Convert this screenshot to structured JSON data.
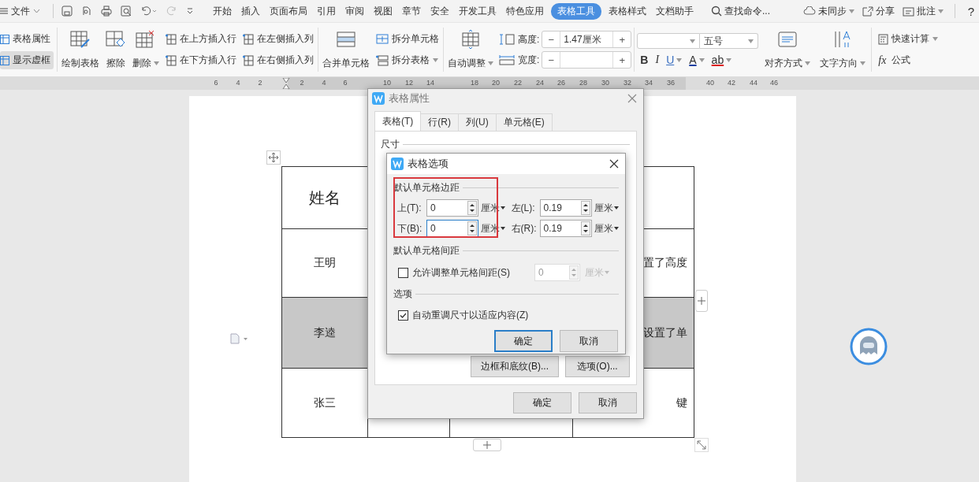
{
  "menu_bar": {
    "file": "文件",
    "tabs": [
      {
        "label": "开始",
        "selected": false
      },
      {
        "label": "插入",
        "selected": false
      },
      {
        "label": "页面布局",
        "selected": false
      },
      {
        "label": "引用",
        "selected": false
      },
      {
        "label": "审阅",
        "selected": false
      },
      {
        "label": "视图",
        "selected": false
      },
      {
        "label": "章节",
        "selected": false
      },
      {
        "label": "安全",
        "selected": false
      },
      {
        "label": "开发工具",
        "selected": false
      },
      {
        "label": "特色应用",
        "selected": false
      },
      {
        "label": "表格工具",
        "selected": true
      },
      {
        "label": "表格样式",
        "selected": false
      },
      {
        "label": "文档助手",
        "selected": false
      }
    ],
    "search": {
      "placeholder": "查找命令..."
    },
    "sync": "未同步",
    "share": "分享",
    "comment": "批注",
    "help": "?"
  },
  "ribbon": {
    "toggles": [
      {
        "label": "表格属性",
        "selected": false
      },
      {
        "label": "显示虚框",
        "selected": true
      }
    ],
    "draw": "绘制表格",
    "erase": "擦除",
    "delete": "删除",
    "insert": [
      "在上方插入行",
      "在下方插入行",
      "在左侧插入列",
      "在右侧插入列"
    ],
    "merge": "合并单元格",
    "split_cells": "拆分单元格",
    "split_table": "拆分表格",
    "autofit": "自动调整",
    "height": {
      "label": "高度:",
      "minus": "−",
      "value": "1.47厘米",
      "plus": "+"
    },
    "width": {
      "label": "宽度:",
      "minus": "−",
      "plus": "+"
    },
    "font_size": "五号",
    "format": [
      "B",
      "I",
      "U",
      "A",
      "ab"
    ],
    "align": "对齐方式",
    "text_direction": "文字方向",
    "quick_calc": "快速计算",
    "formula_icon": "fx",
    "formula": "公式"
  },
  "ruler": [
    "6",
    "4",
    "2",
    "2",
    "4",
    "6",
    "10",
    "12",
    "14",
    "18",
    "20",
    "22",
    "24",
    "26",
    "28",
    "30",
    "32",
    "34",
    "36",
    "40",
    "42",
    "44",
    "46"
  ],
  "table": {
    "rows": [
      {
        "kind": "header",
        "shaded": false,
        "name": "姓名"
      },
      {
        "kind": "body",
        "shaded": false,
        "name": "王明",
        "note": "置了高度"
      },
      {
        "kind": "body",
        "shaded": true,
        "name": "李逵",
        "note": "设置了单"
      },
      {
        "kind": "body",
        "shaded": false,
        "name": "张三",
        "note": "键"
      }
    ]
  },
  "table_properties": {
    "title": "表格属性",
    "tabs": [
      {
        "label": "表格(T)",
        "selected": true
      },
      {
        "label": "行(R)",
        "selected": false
      },
      {
        "label": "列(U)",
        "selected": false
      },
      {
        "label": "单元格(E)",
        "selected": false
      }
    ],
    "section": "尺寸",
    "buttons": [
      "边框和底纹(B)...",
      "选项(O)..."
    ],
    "footer": [
      "确定",
      "取消"
    ]
  },
  "table_options": {
    "title": "表格选项",
    "margins_heading": "默认单元格边距",
    "margins": [
      {
        "label": "上(T):",
        "value": "0",
        "unit": "厘米",
        "focused": false
      },
      {
        "label": "左(L):",
        "value": "0.19",
        "unit": "厘米",
        "focused": false
      },
      {
        "label": "下(B):",
        "value": "0",
        "unit": "厘米",
        "focused": true
      },
      {
        "label": "右(R):",
        "value": "0.19",
        "unit": "厘米",
        "focused": false
      }
    ],
    "spacing_heading": "默认单元格间距",
    "spacing": {
      "label": "允许调整单元格间距(S)",
      "checked": false,
      "value": "0",
      "unit": "厘米",
      "disabled": true
    },
    "options_heading": "选项",
    "autofit": {
      "label": "自动重调尺寸以适应内容(Z)",
      "checked": true
    },
    "buttons": [
      {
        "label": "确定",
        "default": true
      },
      {
        "label": "取消",
        "default": false
      }
    ]
  }
}
